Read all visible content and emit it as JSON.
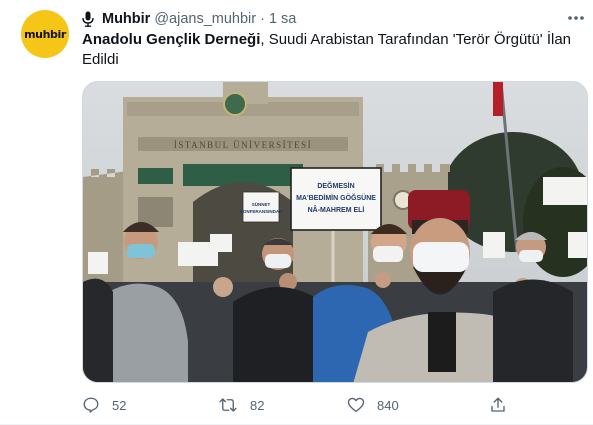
{
  "account": {
    "avatar_text": "muhbir",
    "display_name": "Muhbir",
    "handle": "@ajans_muhbir",
    "separator": "·",
    "time": "1 sa"
  },
  "tweet": {
    "text_bold": "Anadolu Gençlik Derneği",
    "text_rest": ", Suudi Arabistan Tarafından 'Terör Örgütü' İlan Edildi"
  },
  "photo": {
    "gate_inscription": "İSTANBUL ÜNİVERSİTESİ",
    "main_sign": [
      "DEĞMESİN",
      "MA'BEDİMİN GÖĞSÜNE",
      "NÂ-MAHREM ELİ"
    ],
    "small_sign": [
      "SÜNNET",
      "KONFERANSINDAN"
    ]
  },
  "actions": {
    "reply_count": "52",
    "retweet_count": "82",
    "like_count": "840"
  },
  "icons": {
    "mic": "microphone-icon",
    "more": "more-horizontal-icon",
    "reply": "reply-icon",
    "retweet": "retweet-icon",
    "like": "heart-icon",
    "share": "share-icon"
  },
  "colors": {
    "avatar_bg": "#f5c518",
    "text_primary": "#0f1419",
    "text_secondary": "#536471"
  }
}
